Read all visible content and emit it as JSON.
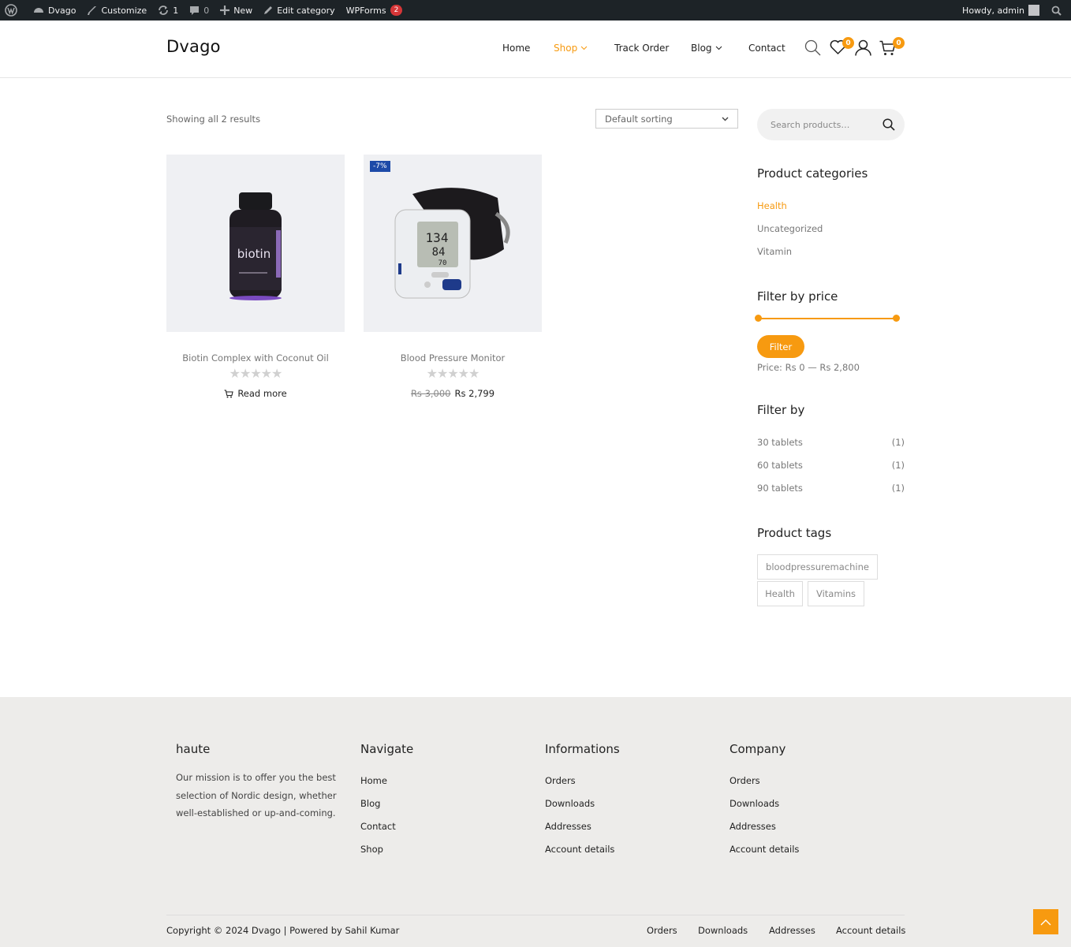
{
  "admin_bar": {
    "site": "Dvago",
    "customize": "Customize",
    "updates_count": "1",
    "comments_count": "0",
    "new": "New",
    "edit": "Edit category",
    "wpforms": "WPForms",
    "wpforms_badge": "2",
    "howdy": "Howdy, admin"
  },
  "header": {
    "logo": "Dvago",
    "nav": [
      "Home",
      "Shop",
      "Track Order",
      "Blog",
      "Contact"
    ],
    "wishlist_count": "0",
    "cart_count": "0"
  },
  "shop": {
    "result_count": "Showing all 2 results",
    "sorting": "Default sorting",
    "products": [
      {
        "title": "Biotin Complex with Coconut Oil",
        "stars": "★★★★★",
        "action": "Read more"
      },
      {
        "title": "Blood Pressure Monitor",
        "stars": "★★★★★",
        "sale_badge": "-7%",
        "old_price": "Rs 3,000",
        "price": "Rs 2,799"
      }
    ]
  },
  "sidebar": {
    "search_placeholder": "Search products…",
    "categories_title": "Product categories",
    "categories": [
      "Health",
      "Uncategorized",
      "Vitamin"
    ],
    "price_title": "Filter by price",
    "filter_button": "Filter",
    "price_label": "Price: Rs 0 — Rs 2,800",
    "price_range": {
      "min": 0,
      "max": 2800
    },
    "filterby_title": "Filter by",
    "filterby": [
      {
        "label": "30 tablets",
        "count": "(1)"
      },
      {
        "label": "60 tablets",
        "count": "(1)"
      },
      {
        "label": "90 tablets",
        "count": "(1)"
      }
    ],
    "tags_title": "Product tags",
    "tags": [
      "bloodpressuremachine",
      "Health",
      "Vitamins"
    ]
  },
  "footer": {
    "col1_title": "haute",
    "col1_text": "Our mission is to offer you the best selection of Nordic design, whether well-established or up-and-coming.",
    "col2_title": "Navigate",
    "col2_links": [
      "Home",
      "Blog",
      "Contact",
      "Shop"
    ],
    "col3_title": "Informations",
    "col3_links": [
      "Orders",
      "Downloads",
      "Addresses",
      "Account details"
    ],
    "col4_title": "Company",
    "col4_links": [
      "Orders",
      "Downloads",
      "Addresses",
      "Account details"
    ],
    "copyright": "Copyright © 2024 Dvago | Powered by Sahil Kumar",
    "bottom_links": [
      "Orders",
      "Downloads",
      "Addresses",
      "Account details"
    ]
  },
  "colors": {
    "accent": "#f79a10",
    "admin_bar": "#1d2327",
    "footer_bg": "#edecea",
    "sale_badge": "#1d4aa8"
  },
  "icons": [
    "wordpress-icon",
    "dashboard-icon",
    "brush-icon",
    "updates-icon",
    "comment-icon",
    "plus-icon",
    "pencil-icon",
    "search-icon",
    "heart-icon",
    "user-icon",
    "cart-icon",
    "chevron-down-icon",
    "arrow-up-icon"
  ]
}
